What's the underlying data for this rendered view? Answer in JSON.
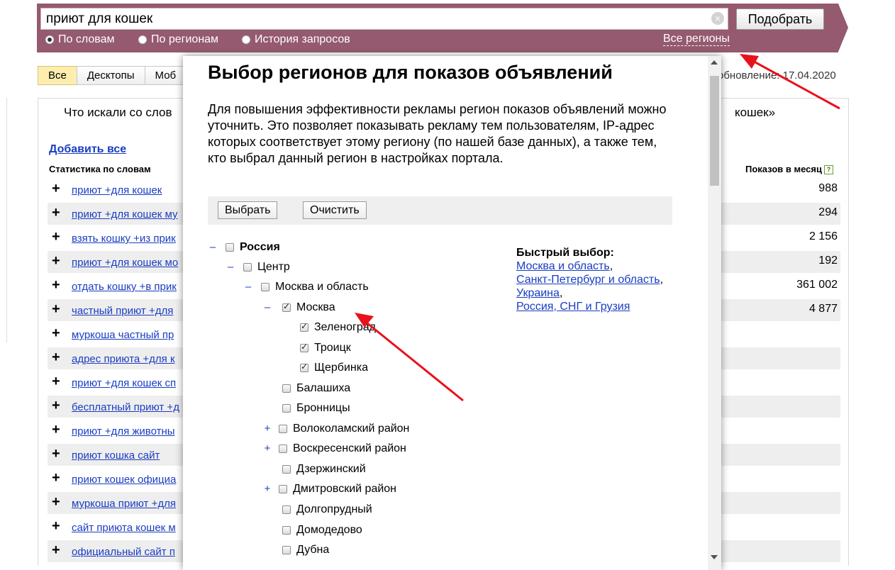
{
  "search": {
    "query": "приют для кошек",
    "clear_icon": "close-circle-icon",
    "button_label": "Подобрать"
  },
  "modes": [
    {
      "label": "По словам",
      "selected": true
    },
    {
      "label": "По регионам",
      "selected": false
    },
    {
      "label": "История запросов",
      "selected": false
    }
  ],
  "all_regions_link": "Все регионы",
  "tabs": [
    "Все",
    "Десктопы",
    "Моб"
  ],
  "update_date": "обновление: 17.04.2020",
  "results": {
    "heading_left": "Что искали со слов",
    "heading_right": "кошек»",
    "add_all": "Добавить все",
    "col_words": "Статистика по словам",
    "col_shows": "Показов в месяц",
    "help_icon": "?",
    "rows": [
      {
        "kw": "приют +для кошек",
        "count": "988"
      },
      {
        "kw": "приют +для кошек му",
        "count": "294"
      },
      {
        "kw": "взять кошку +из прик",
        "count": "2 156"
      },
      {
        "kw": "приют +для кошек мо",
        "count": "192"
      },
      {
        "kw": "отдать кошку +в прик",
        "count": "361 002"
      },
      {
        "kw": "частный приют +для",
        "count": "4 877"
      },
      {
        "kw": "муркоша частный пр",
        "count": ""
      },
      {
        "kw": "адрес приюта +для к",
        "count": ""
      },
      {
        "kw": "приют +для кошек сп",
        "count": ""
      },
      {
        "kw": "бесплатный приют +д",
        "count": ""
      },
      {
        "kw": "приют +для животны",
        "count": ""
      },
      {
        "kw": "приют кошка сайт",
        "count": ""
      },
      {
        "kw": "приют кошек официа",
        "count": ""
      },
      {
        "kw": "муркоша приют +для",
        "count": ""
      },
      {
        "kw": "сайт приюта кошек м",
        "count": ""
      },
      {
        "kw": "официальный сайт п",
        "count": ""
      }
    ]
  },
  "modal": {
    "title": "Выбор регионов для показов объявлений",
    "description": "Для повышения эффективности рекламы регион показов объявлений можно уточнить. Это позволяет показывать рекламу тем пользователям, IP-адрес которых соответствует этому региону (по нашей базе данных), а также тем, кто выбрал данный регион в настройках портала.",
    "select_button": "Выбрать",
    "clear_button": "Очистить",
    "tree": [
      {
        "label": "Россия",
        "toggle": "–",
        "checked": false,
        "bold": true
      },
      {
        "label": "Центр",
        "toggle": "–",
        "checked": false
      },
      {
        "label": "Москва и область",
        "toggle": "–",
        "checked": false
      },
      {
        "label": "Москва",
        "toggle": "–",
        "checked": true
      },
      {
        "label": "Зеленоград",
        "toggle": "",
        "checked": true
      },
      {
        "label": "Троицк",
        "toggle": "",
        "checked": true
      },
      {
        "label": "Щербинка",
        "toggle": "",
        "checked": true
      },
      {
        "label": "Балашиха",
        "toggle": "",
        "checked": false
      },
      {
        "label": "Бронницы",
        "toggle": "",
        "checked": false
      },
      {
        "label": "Волоколамский район",
        "toggle": "+",
        "checked": false
      },
      {
        "label": "Воскресенский район",
        "toggle": "+",
        "checked": false
      },
      {
        "label": "Дзержинский",
        "toggle": "",
        "checked": false
      },
      {
        "label": "Дмитровский район",
        "toggle": "+",
        "checked": false
      },
      {
        "label": "Долгопрудный",
        "toggle": "",
        "checked": false
      },
      {
        "label": "Домодедово",
        "toggle": "",
        "checked": false
      },
      {
        "label": "Дубна",
        "toggle": "",
        "checked": false
      }
    ],
    "quick": {
      "title": "Быстрый выбор:",
      "links": [
        "Москва и область",
        "Санкт-Петербург и область",
        "Украина",
        "Россия, СНГ и Грузия"
      ]
    }
  },
  "colors": {
    "band": "#955a6f",
    "link": "#1a3dc1",
    "annotation": "#e8121c"
  }
}
